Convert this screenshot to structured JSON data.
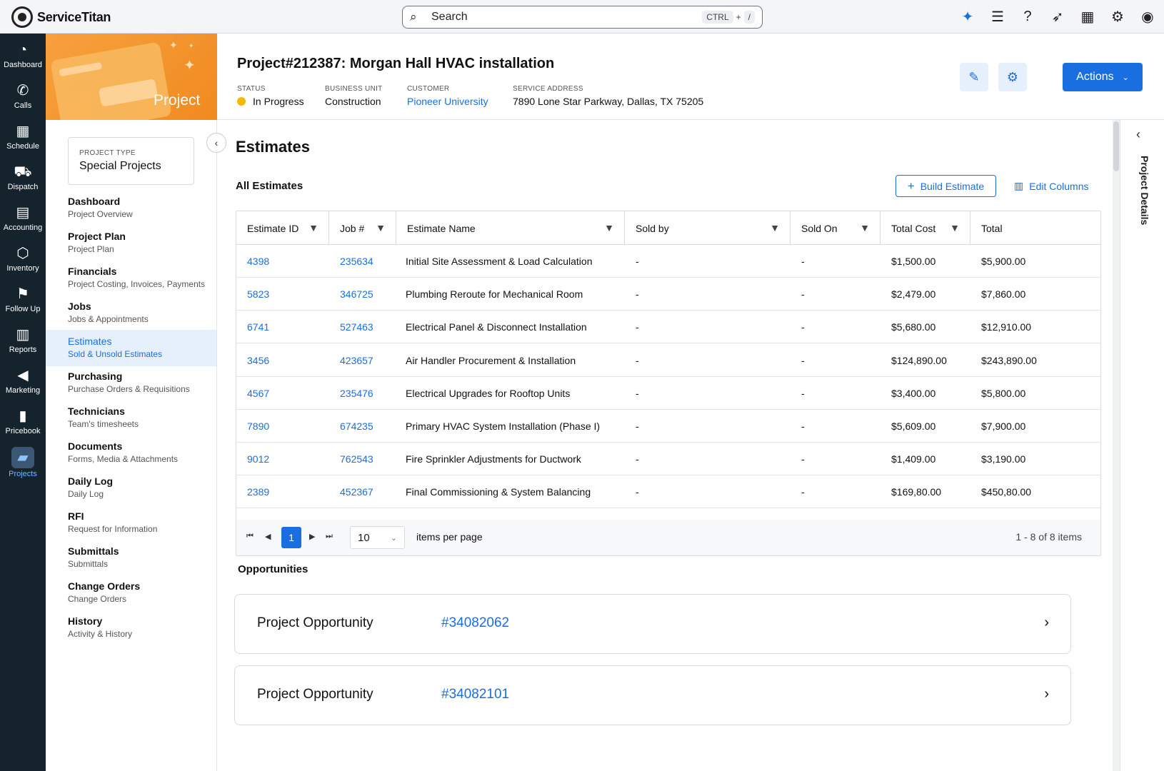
{
  "app": {
    "brand": "ServiceTitan"
  },
  "search": {
    "label": "Search",
    "shortcut_ctrl": "CTRL",
    "shortcut_plus": "+",
    "shortcut_key": "/"
  },
  "topicons": [
    "titan-ai-icon",
    "search-list-icon",
    "help-icon",
    "rocket-icon",
    "marketplace-icon",
    "settings-icon",
    "user-avatar-icon"
  ],
  "leftnav": [
    {
      "label": "Dashboard",
      "icon": "dashboard-icon",
      "glyph": "◔"
    },
    {
      "label": "Calls",
      "icon": "phone-icon",
      "glyph": "✆"
    },
    {
      "label": "Schedule",
      "icon": "calendar-icon",
      "glyph": "▦"
    },
    {
      "label": "Dispatch",
      "icon": "truck-icon",
      "glyph": "⛟"
    },
    {
      "label": "Accounting",
      "icon": "clipboard-icon",
      "glyph": "▤"
    },
    {
      "label": "Inventory",
      "icon": "box-icon",
      "glyph": "⬡"
    },
    {
      "label": "Follow Up",
      "icon": "flag-icon",
      "glyph": "⚑"
    },
    {
      "label": "Reports",
      "icon": "chart-icon",
      "glyph": "▥"
    },
    {
      "label": "Marketing",
      "icon": "megaphone-icon",
      "glyph": "◀"
    },
    {
      "label": "Pricebook",
      "icon": "book-icon",
      "glyph": "▮"
    },
    {
      "label": "Projects",
      "icon": "folder-icon",
      "glyph": "▰",
      "active": true
    }
  ],
  "banner": {
    "title": "Project"
  },
  "project_type": {
    "label": "PROJECT TYPE",
    "value": "Special Projects"
  },
  "menu": [
    {
      "title": "Dashboard",
      "subtitle": "Project Overview"
    },
    {
      "title": "Project Plan",
      "subtitle": "Project Plan"
    },
    {
      "title": "Financials",
      "subtitle": "Project Costing, Invoices, Payments"
    },
    {
      "title": "Jobs",
      "subtitle": "Jobs & Appointments"
    },
    {
      "title": "Estimates",
      "subtitle": "Sold & Unsold Estimates",
      "active": true
    },
    {
      "title": "Purchasing",
      "subtitle": "Purchase Orders & Requisitions"
    },
    {
      "title": "Technicians",
      "subtitle": "Team's timesheets"
    },
    {
      "title": "Documents",
      "subtitle": "Forms, Media & Attachments"
    },
    {
      "title": "Daily Log",
      "subtitle": "Daily Log"
    },
    {
      "title": "RFI",
      "subtitle": "Request for Information"
    },
    {
      "title": "Submittals",
      "subtitle": "Submittals"
    },
    {
      "title": "Change Orders",
      "subtitle": "Change Orders"
    },
    {
      "title": "History",
      "subtitle": "Activity & History"
    }
  ],
  "header": {
    "title": "Project#212387:  Morgan Hall HVAC installation",
    "status_label": "STATUS",
    "status_value": "In Progress",
    "status_color": "#f5b800",
    "bu_label": "BUSINESS UNIT",
    "bu_value": "Construction",
    "customer_label": "CUSTOMER",
    "customer_value": "Pioneer University",
    "address_label": "SERVICE ADDRESS",
    "address_value": "7890 Lone Star Parkway, Dallas, TX 75205",
    "actions_label": "Actions"
  },
  "rail": {
    "label": "Project Details"
  },
  "main": {
    "title": "Estimates",
    "all_estimates": "All Estimates",
    "build_estimate": "Build Estimate",
    "edit_columns": "Edit Columns",
    "opportunities_title": "Opportunities"
  },
  "table": {
    "columns": [
      "Estimate ID",
      "Job #",
      "Estimate Name",
      "Sold by",
      "Sold On",
      "Total Cost",
      "Total"
    ],
    "rows": [
      [
        "4398",
        "235634",
        "Initial Site Assessment & Load Calculation",
        "-",
        "-",
        "$1,500.00",
        "$5,900.00"
      ],
      [
        "5823",
        "346725",
        "Plumbing Reroute for Mechanical Room",
        "-",
        "-",
        "$2,479.00",
        "$7,860.00"
      ],
      [
        "6741",
        "527463",
        "Electrical Panel & Disconnect Installation",
        "-",
        "-",
        "$5,680.00",
        "$12,910.00"
      ],
      [
        "3456",
        "423657",
        "Air Handler Procurement & Installation",
        "-",
        "-",
        "$124,890.00",
        "$243,890.00"
      ],
      [
        "4567",
        "235476",
        "Electrical Upgrades for Rooftop Units",
        "-",
        "-",
        "$3,400.00",
        "$5,800.00"
      ],
      [
        "7890",
        "674235",
        "Primary HVAC System Installation (Phase I)",
        "-",
        "-",
        "$5,609.00",
        "$7,900.00"
      ],
      [
        "9012",
        "762543",
        "Fire Sprinkler Adjustments for Ductwork",
        "-",
        "-",
        "$1,409.00",
        "$3,190.00"
      ],
      [
        "2389",
        "452367",
        "Final Commissioning & System Balancing",
        "-",
        "-",
        "$169,80.00",
        "$450,80.00"
      ]
    ],
    "page": "1",
    "per_page": "10",
    "items_per_page": "items per page",
    "count": "1 - 8 of 8 items"
  },
  "opportunities": [
    {
      "label": "Project Opportunity",
      "number": "#34082062"
    },
    {
      "label": "Project Opportunity",
      "number": "#34082101"
    }
  ],
  "colors": {
    "brand_blue": "#1a6fe0",
    "nav_bg": "#14232c",
    "banner_orange": "#f39a2e"
  }
}
